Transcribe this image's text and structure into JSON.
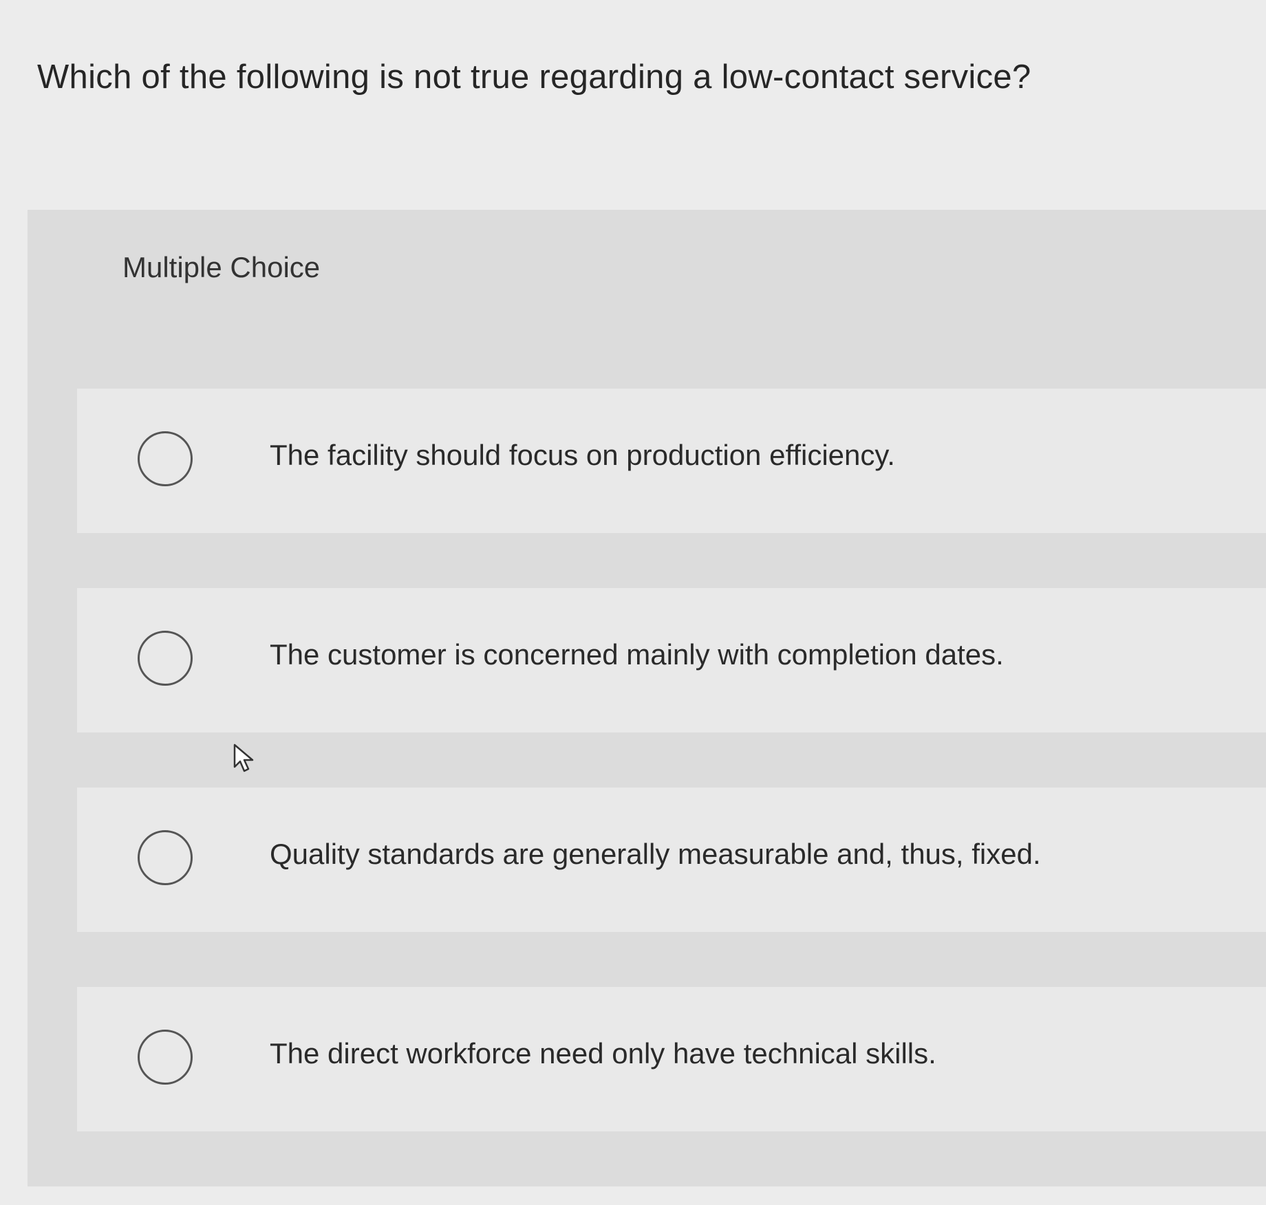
{
  "question": {
    "text": "Which of the following is not true regarding a low-contact service?"
  },
  "question_type": "Multiple Choice",
  "choices": [
    {
      "label": "The facility should focus on production efficiency."
    },
    {
      "label": "The customer is concerned mainly with completion dates."
    },
    {
      "label": "Quality standards are generally measurable and, thus, fixed."
    },
    {
      "label": "The direct workforce need only have technical skills."
    }
  ],
  "icons": {
    "radio": "radio-unchecked-icon",
    "cursor": "mouse-pointer-icon"
  }
}
